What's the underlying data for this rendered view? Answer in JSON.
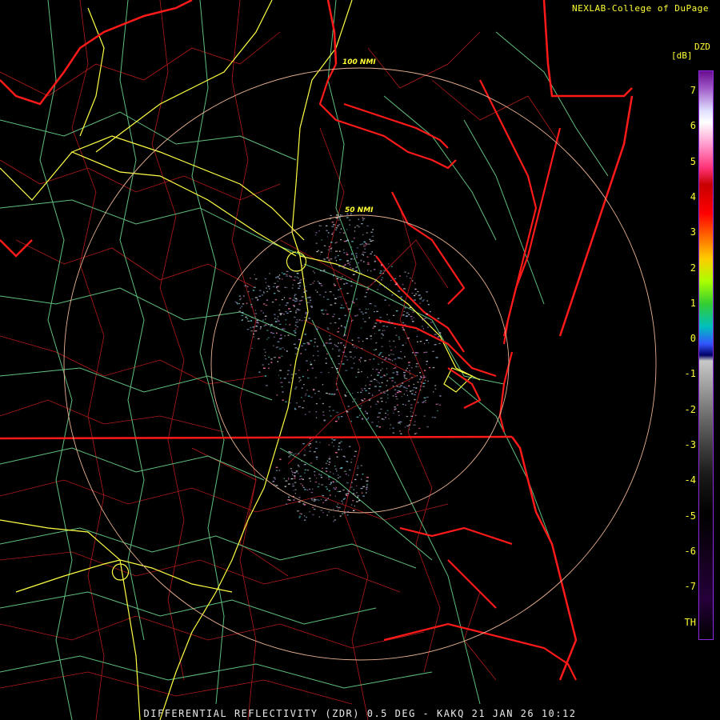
{
  "header": {
    "credit": "NEXLAB-College of DuPage"
  },
  "footer": {
    "caption": "DIFFERENTIAL REFLECTIVITY (ZDR) 0.5 DEG - KAKQ 21 JAN 26 10:12"
  },
  "range_rings": {
    "outer_label": "100 NMI",
    "inner_label": "50 NMI"
  },
  "legend": {
    "product": "DZD",
    "unit": "[dB]",
    "ticks": [
      "7",
      "6",
      "5",
      "4",
      "3",
      "2",
      "1",
      "0",
      "-1",
      "-2",
      "-3",
      "-4",
      "-5",
      "-6",
      "-7",
      "TH"
    ]
  },
  "colors": {
    "background": "#000000",
    "state_border": "#ff1a1a",
    "county_border": "#cc1f1f",
    "interstate": "#ffff44",
    "highway": "#66cc88",
    "range_ring": "#e8b090",
    "label": "#ffff33"
  }
}
